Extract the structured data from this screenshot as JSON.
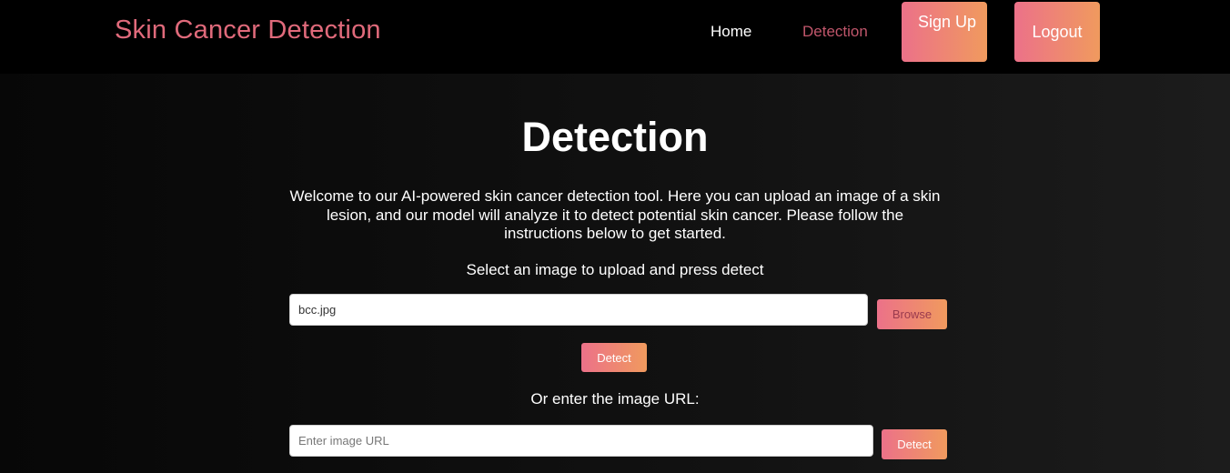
{
  "nav": {
    "brand": "Skin Cancer Detection",
    "home": "Home",
    "detection": "Detection",
    "signup": "Sign Up",
    "logout": "Logout"
  },
  "main": {
    "title": "Detection",
    "intro": "Welcome to our AI-powered skin cancer detection tool. Here you can upload an image of a skin lesion, and our model will analyze it to detect potential skin cancer. Please follow the instructions below to get started.",
    "instruction": "Select an image to upload and press detect",
    "file_value": "bcc.jpg",
    "browse_label": "Browse",
    "detect_label": "Detect",
    "or_text": "Or enter the image URL:",
    "url_placeholder": "Enter image URL",
    "url_detect_label": "Detect"
  },
  "colors": {
    "brand": "#e06a7b",
    "active_link": "#c0566b",
    "gradient_start": "#ec7189",
    "gradient_end": "#f09a5e"
  }
}
